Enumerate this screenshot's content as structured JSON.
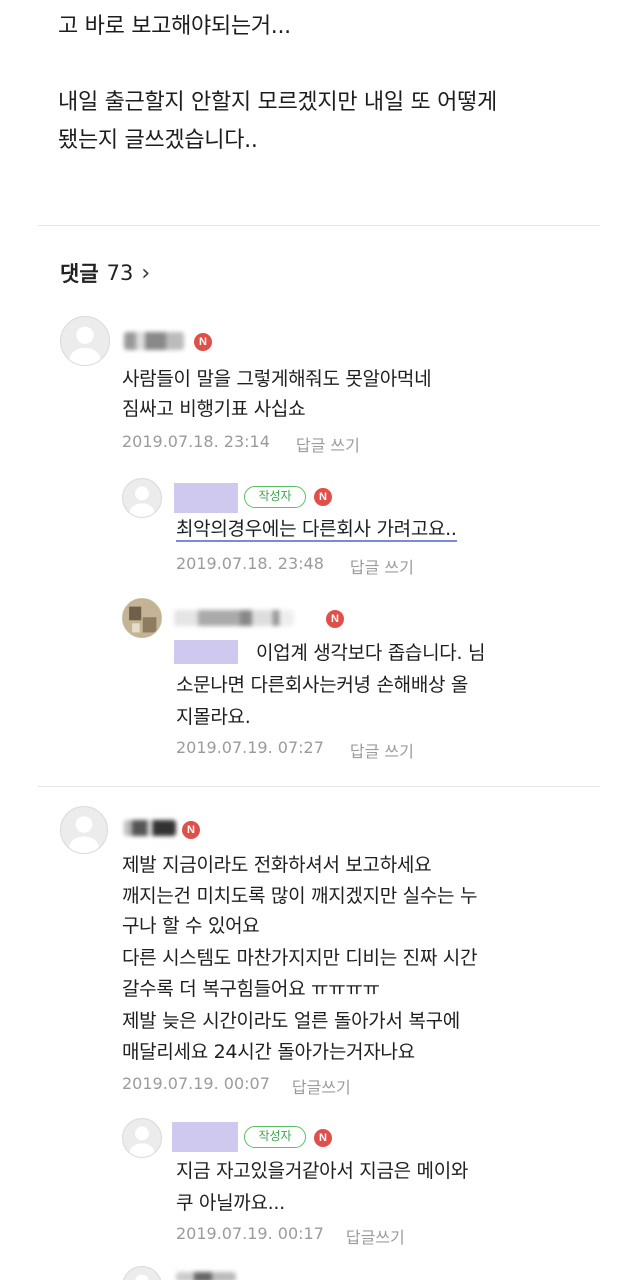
{
  "post": {
    "line1": "고 바로 보고해야되는거...",
    "line2": "내일 출근할지 안할지 모르겠지만 내일 또 어떻게",
    "line3": "됐는지 글쓰겠습니다.."
  },
  "comments_header": {
    "label": "댓글",
    "count": "73",
    "chevron": "›"
  },
  "comments": [
    {
      "lines": [
        "사람들이 말을 그렇게해줘도 못알아먹네",
        "짐싸고 비행기표 사십쇼"
      ],
      "date": "2019.07.18. 23:14",
      "reply": "답글 쓰기",
      "badge": "N"
    },
    {
      "author_tag": "작성자",
      "lines": [
        "최악의경우에는 다른회사 가려고요.."
      ],
      "date": "2019.07.18. 23:48",
      "reply": "답글 쓰기",
      "badge": "N"
    },
    {
      "lines": [
        "이업계 생각보다 좁습니다. 님",
        "소문나면 다른회사는커녕 손해배상 올",
        "지몰라요."
      ],
      "date": "2019.07.19. 07:27",
      "reply": "답글 쓰기",
      "badge": "N"
    },
    {
      "lines": [
        "제발 지금이라도 전화하셔서 보고하세요",
        "깨지는건 미치도록 많이 깨지겠지만 실수는 누",
        "구나 할 수 있어요",
        "다른 시스템도 마찬가지지만 디비는 진짜 시간",
        "갈수록 더 복구힘들어요 ㅠㅠㅠㅠ",
        "제발 늦은 시간이라도 얼른 돌아가서 복구에",
        "매달리세요 24시간 돌아가는거자나요"
      ],
      "date": "2019.07.19. 00:07",
      "reply": "답글쓰기",
      "badge": "N"
    },
    {
      "author_tag": "작성자",
      "lines": [
        "지금 자고있을거같아서 지금은 메이와",
        "쿠 아닐까요..."
      ],
      "date": "2019.07.19. 00:17",
      "reply": "답글쓰기",
      "badge": "N"
    }
  ],
  "colors": {
    "badge": "#e0504a",
    "author_tag": "#3ea64a",
    "name_box": "#cfc9ef",
    "meta": "#9b9b9b"
  }
}
